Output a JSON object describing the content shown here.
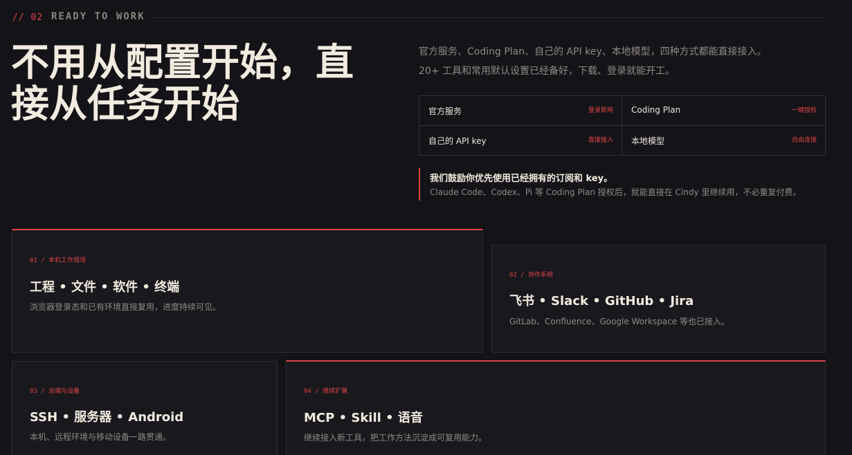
{
  "section": {
    "number": "// 02",
    "title": "READY TO WORK"
  },
  "hero": {
    "title_line1": "不用从配置开始，直",
    "title_line2": "接从任务开始"
  },
  "intro": {
    "line1": "官方服务、Coding Plan、自己的 API key、本地模型，四种方式都能直接接入。",
    "line2": "20+ 工具和常用默认设置已经备好，下载、登录就能开工。"
  },
  "access": [
    {
      "name": "官方服务",
      "tag": "登录即用"
    },
    {
      "name": "Coding Plan",
      "tag": "一键授权"
    },
    {
      "name": "自己的 API key",
      "tag": "直接接入"
    },
    {
      "name": "本地模型",
      "tag": "自由连接"
    }
  ],
  "callout": {
    "title": "我们鼓励你优先使用已经拥有的订阅和 key。",
    "text": "Claude Code、Codex、Pi 等 Coding Plan 授权后，就能直接在 Cindy 里继续用，不必重复付费。"
  },
  "cards": [
    {
      "kicker": "01 / 本机工作现场",
      "title": "工程 • 文件 • 软件 • 终端",
      "desc": "浏览器登录态和已有环境直接复用，进度持续可见。"
    },
    {
      "kicker": "02 / 协作系统",
      "title": "飞书 • Slack • GitHub • Jira",
      "desc": "GitLab、Confluence、Google Workspace 等也已接入。"
    },
    {
      "kicker": "03 / 远端与设备",
      "title": "SSH • 服务器 • Android",
      "desc": "本机、远程环境与移动设备一路贯通。"
    },
    {
      "kicker": "04 / 继续扩展",
      "title": "MCP • Skill • 语音",
      "desc": "继续接入新工具，把工作方法沉淀成可复用能力。"
    }
  ],
  "colors": {
    "background": "#141317",
    "accent": "#e04545",
    "text": "#f1ebe0",
    "muted": "#8f8a84",
    "card": "#19181d",
    "border": "#2f2e35"
  }
}
